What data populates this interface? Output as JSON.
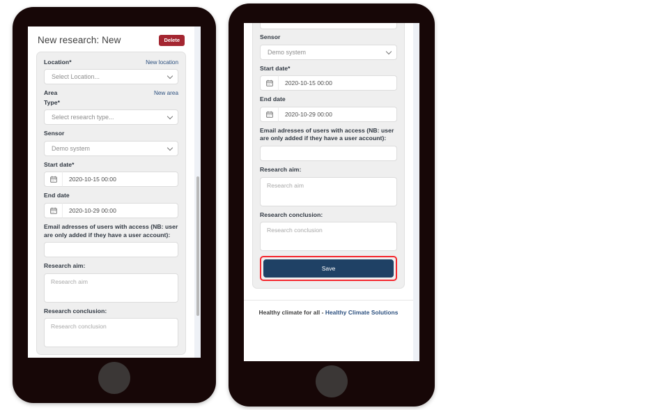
{
  "app": {
    "page_title": "New research: New",
    "delete_label": "Delete",
    "save_label": "Save",
    "footer_text": "Healthy climate for all - ",
    "footer_brand": "Healthy Climate Solutions",
    "accent_navy": "#1f4165",
    "accent_red": "#a42631",
    "highlight_red": "#f5252c",
    "link_blue": "#2b4f7e",
    "card_bg": "#efefef",
    "frame_color": "#170707"
  },
  "form": {
    "location": {
      "label": "Location*",
      "link": "New location",
      "selected": "Select Location...",
      "icon": "chevron-down-icon"
    },
    "area": {
      "label": "Area",
      "link": "New area"
    },
    "type": {
      "label": "Type*",
      "selected": "Select research type...",
      "icon": "chevron-down-icon"
    },
    "sensor": {
      "label": "Sensor",
      "selected": "Demo system",
      "icon": "chevron-down-icon"
    },
    "start_date": {
      "label": "Start date*",
      "value": "2020-10-15 00:00",
      "icon": "calendar-icon"
    },
    "end_date": {
      "label": "End date",
      "value": "2020-10-29 00:00",
      "icon": "calendar-icon"
    },
    "emails": {
      "label": "Email adresses of users with access (NB: user are only added if they have a user account):",
      "value": ""
    },
    "research_aim": {
      "label": "Research aim:",
      "placeholder": "Research aim"
    },
    "research_conclusion": {
      "label": "Research conclusion:",
      "placeholder": "Research conclusion"
    }
  },
  "phones": {
    "left_name": "phone-mockup-left-top-of-form",
    "right_name": "phone-mockup-right-scrolled-to-save"
  }
}
